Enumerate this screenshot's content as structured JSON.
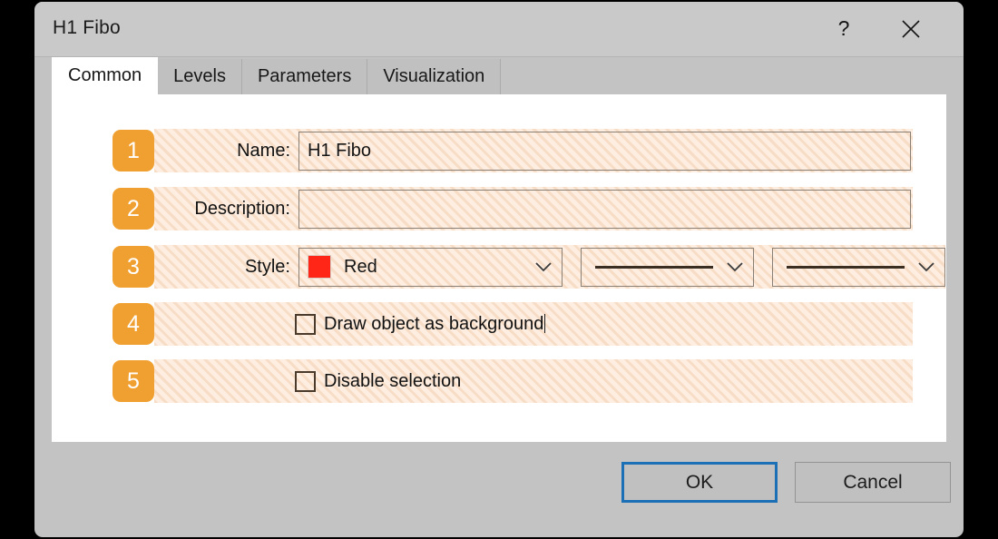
{
  "window": {
    "title": "H1 Fibo",
    "help_icon": "question-mark-icon",
    "close_icon": "close-icon"
  },
  "tabs": [
    {
      "label": "Common",
      "active": true
    },
    {
      "label": "Levels",
      "active": false
    },
    {
      "label": "Parameters",
      "active": false
    },
    {
      "label": "Visualization",
      "active": false
    }
  ],
  "form": {
    "rows": [
      {
        "badge": "1",
        "label": "Name:",
        "value": "H1 Fibo"
      },
      {
        "badge": "2",
        "label": "Description:",
        "value": ""
      },
      {
        "badge": "3",
        "label": "Style:"
      },
      {
        "badge": "4",
        "label": "Draw object as background"
      },
      {
        "badge": "5",
        "label": "Disable selection"
      }
    ],
    "style": {
      "color_name": "Red",
      "color_hex": "#ff2517",
      "line_width_icon": "solid-line-icon",
      "line_style_icon": "solid-line-icon"
    },
    "checkboxes": {
      "draw_as_background": false,
      "disable_selection": false
    }
  },
  "footer": {
    "ok_label": "OK",
    "cancel_label": "Cancel"
  },
  "colors": {
    "badge": "#f0a030",
    "accent": "#1a6fb5",
    "highlight_band": "#fbe6d4",
    "chrome": "#c3c3c3"
  }
}
